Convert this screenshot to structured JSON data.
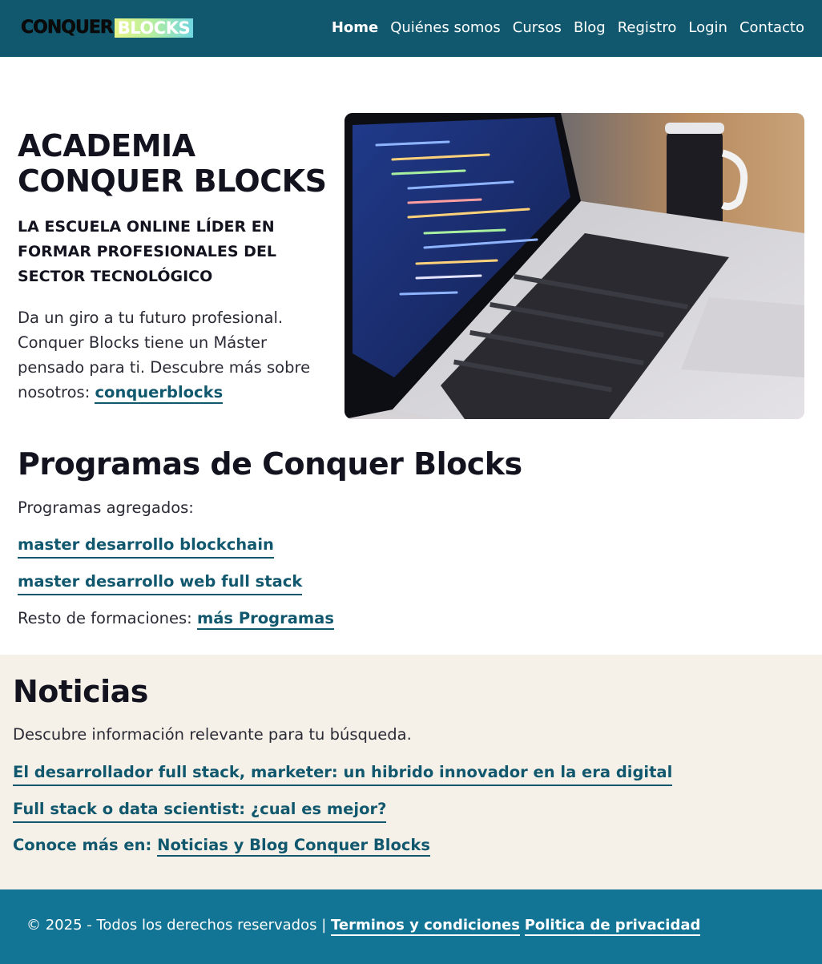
{
  "header": {
    "logo_part1": "CONQUER",
    "logo_part2": "BLOCKS",
    "nav": [
      {
        "label": "Home",
        "active": true
      },
      {
        "label": "Quiénes somos"
      },
      {
        "label": "Cursos"
      },
      {
        "label": "Blog"
      },
      {
        "label": "Registro"
      },
      {
        "label": "Login"
      },
      {
        "label": "Contacto"
      }
    ]
  },
  "hero": {
    "title": "ACADEMIA CONQUER BLOCKS",
    "subtitle": "LA ESCUELA ONLINE LÍDER EN FORMAR PROFESIONALES DEL SECTOR TECNOLÓGICO",
    "text": "Da un giro a tu futuro profesional. Conquer Blocks tiene un Máster pensado para ti. Descubre más sobre nosotros:",
    "link": "conquerblocks",
    "image_icon": "laptop-with-code-photo"
  },
  "programs": {
    "title": "Programas de Conquer Blocks",
    "intro": "Programas agregados:",
    "items": [
      "master desarrollo blockchain",
      "master desarrollo web full stack"
    ],
    "rest_label": "Resto de formaciones:",
    "rest_link": "más Programas"
  },
  "news": {
    "title": "Noticias",
    "intro": "Descubre información relevante para tu búsqueda.",
    "items": [
      "El desarrollador full stack, marketer: un hibrido innovador en la era digital",
      "Full stack o data scientist: ¿cual es mejor?"
    ],
    "more_label": "Conoce más en:",
    "more_link": "Noticias y Blog Conquer Blocks"
  },
  "footer": {
    "copyright": "© 2025 - Todos los derechos reservados |",
    "terms": "Terminos y condiciones",
    "privacy": "Politica de privacidad"
  },
  "colors": {
    "header_bg": "#11586e",
    "link": "#11586e",
    "news_bg": "#f6f1e8",
    "footer_bg": "#137596"
  }
}
